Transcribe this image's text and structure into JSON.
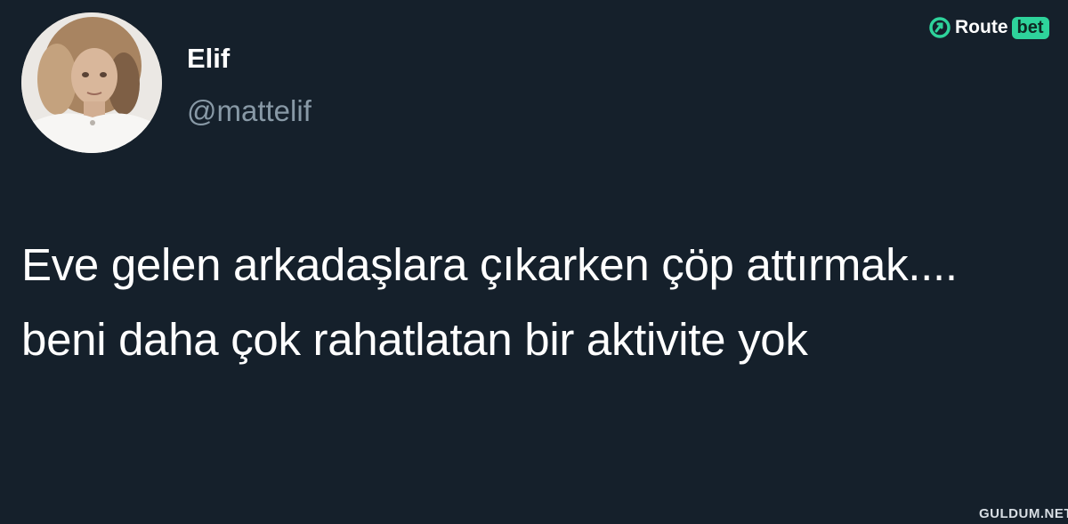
{
  "tweet": {
    "author": {
      "display_name": "Elif",
      "handle": "@mattelif"
    },
    "text": "Eve gelen arkadaşlara çıkarken çöp attırmak.... beni daha çok rahatlatan bir aktivite yok"
  },
  "branding": {
    "logo_text": "Route",
    "logo_badge": "bet",
    "logo_color": "#2ed39b",
    "watermark": "GULDUM.NET"
  },
  "colors": {
    "background": "#15202b",
    "text": "#ffffff",
    "secondary_text": "#8899a6"
  }
}
